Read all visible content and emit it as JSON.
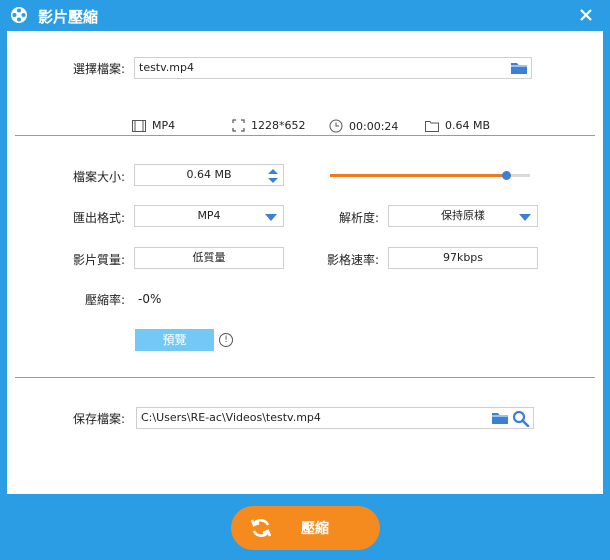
{
  "window": {
    "title": "影片壓縮"
  },
  "file_select": {
    "label": "選擇檔案:",
    "value": "testv.mp4",
    "info": {
      "format": "MP4",
      "resolution": "1228*652",
      "duration": "00:00:24",
      "size": "0.64 MB"
    }
  },
  "settings": {
    "file_size": {
      "label": "檔案大小:",
      "value": "0.64 MB",
      "slider_fraction": 0.88
    },
    "output_format": {
      "label": "匯出格式:",
      "value": "MP4"
    },
    "resolution": {
      "label": "解析度:",
      "value": "保持原樣"
    },
    "quality": {
      "label": "影片質量:",
      "value": "低質量"
    },
    "bitrate": {
      "label": "影格速率:",
      "value": "97kbps"
    },
    "compression": {
      "label": "壓縮率:",
      "value": "-0%"
    },
    "preview_label": "預覽"
  },
  "save": {
    "label": "保存檔案:",
    "value": "C:\\Users\\RE-ac\\Videos\\testv.mp4"
  },
  "compress_button": {
    "label": "壓縮"
  },
  "colors": {
    "accent": "#2a9de5",
    "orange": "#f58a1f",
    "icon_blue": "#3b7fd6"
  }
}
